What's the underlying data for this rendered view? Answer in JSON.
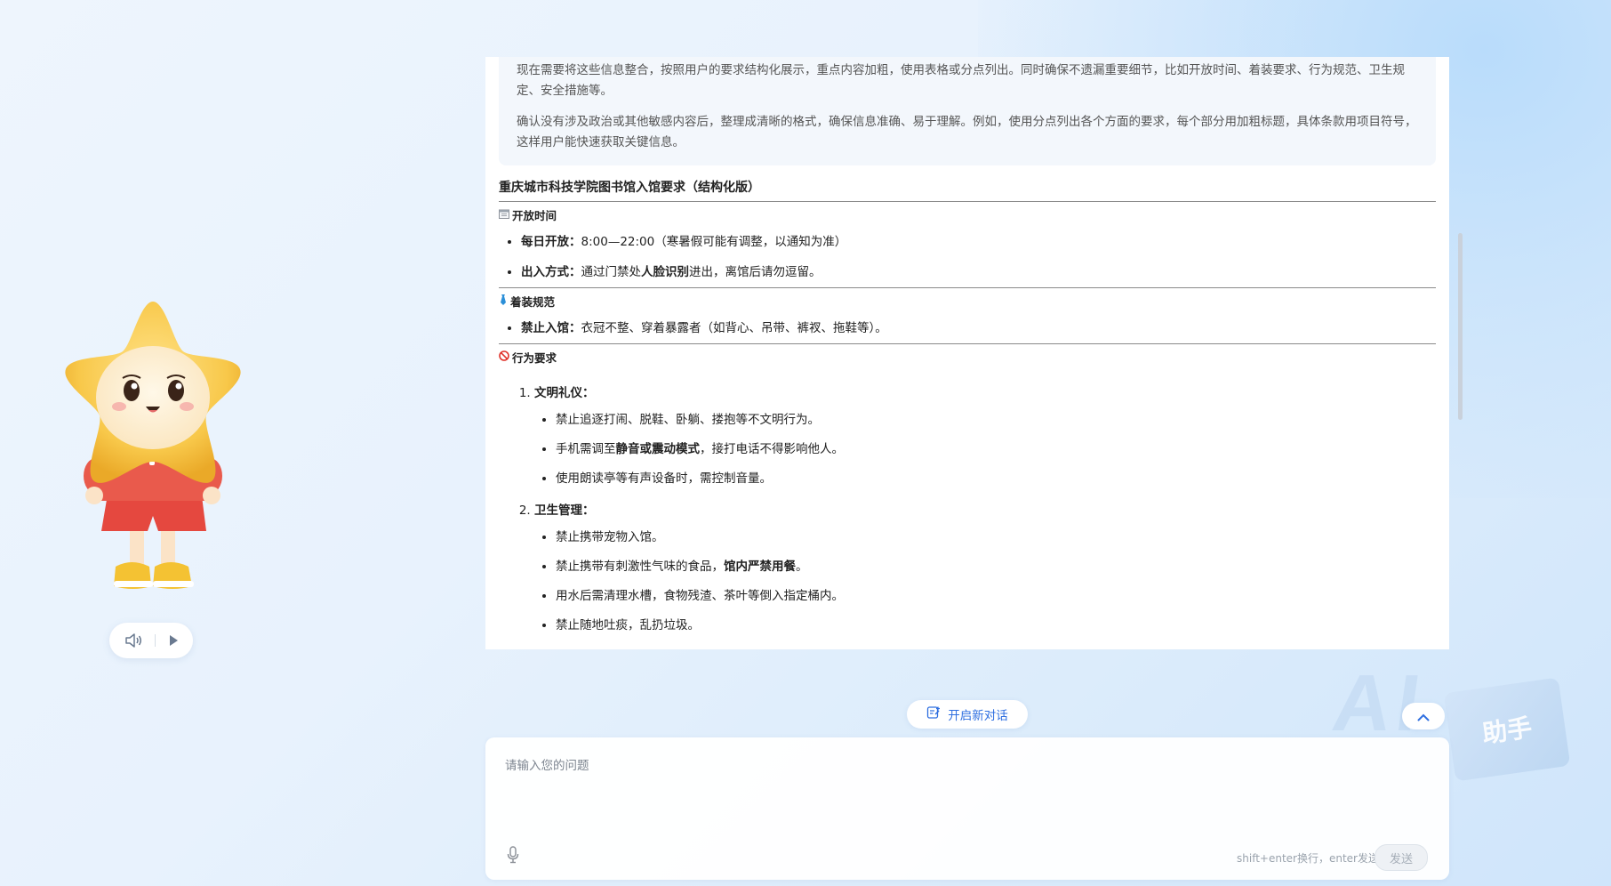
{
  "thinking": {
    "paragraphs": [
      "现在需要将这些信息整合，按照用户的要求结构化展示，重点内容加粗，使用表格或分点列出。同时确保不遗漏重要细节，比如开放时间、着装要求、行为规范、卫生规定、安全措施等。",
      "确认没有涉及政治或其他敏感内容后，整理成清晰的格式，确保信息准确、易于理解。例如，使用分点列出各个方面的要求，每个部分用加粗标题，具体条款用项目符号，这样用户能快速获取关键信息。"
    ]
  },
  "doc": {
    "title": "重庆城市科技学院图书馆入馆要求（结构化版）",
    "sections": {
      "open": {
        "heading": "开放时间",
        "icon": "calendar-icon",
        "items": [
          {
            "bold": "每日开放：",
            "text": "8:00—22:00（寒暑假可能有调整，以通知为准）"
          },
          {
            "bold": "出入方式：",
            "text_before": "通过门禁处",
            "bold2": "人脸识别",
            "text_after": "进出，离馆后请勿逗留。"
          }
        ]
      },
      "dress": {
        "heading": "着装规范",
        "icon": "necktie-icon",
        "items": [
          {
            "bold": "禁止入馆：",
            "text": "衣冠不整、穿着暴露者（如背心、吊带、裤衩、拖鞋等）。"
          }
        ]
      },
      "behavior": {
        "heading": "行为要求",
        "icon": "prohibited-icon",
        "groups": [
          {
            "title": "文明礼仪：",
            "items": [
              {
                "text": "禁止追逐打闹、脱鞋、卧躺、搂抱等不文明行为。"
              },
              {
                "text_before": "手机需调至",
                "bold": "静音或震动模式",
                "text_after": "，接打电话不得影响他人。"
              },
              {
                "text": "使用朗读亭等有声设备时，需控制音量。"
              }
            ]
          },
          {
            "title": "卫生管理：",
            "items": [
              {
                "text": "禁止携带宠物入馆。"
              },
              {
                "text_before": "禁止携带有刺激性气味的食品，",
                "bold": "馆内严禁用餐",
                "text_after": "。"
              },
              {
                "text": "用水后需清理水槽，食物残渣、茶叶等倒入指定桶内。"
              },
              {
                "text": "禁止随地吐痰，乱扔垃圾。"
              }
            ]
          }
        ]
      }
    }
  },
  "new_chat": {
    "label": "开启新对话",
    "icon": "new-chat-icon"
  },
  "input": {
    "placeholder": "请输入您的问题",
    "hint": "shift+enter换行，enter发送",
    "send_label": "发送"
  },
  "background": {
    "watermark_ai": "AI",
    "watermark_helper": "助手"
  },
  "colors": {
    "accent": "#2f6fe0",
    "mascot_body": "#f6c445",
    "mascot_shirt": "#e5483f"
  }
}
